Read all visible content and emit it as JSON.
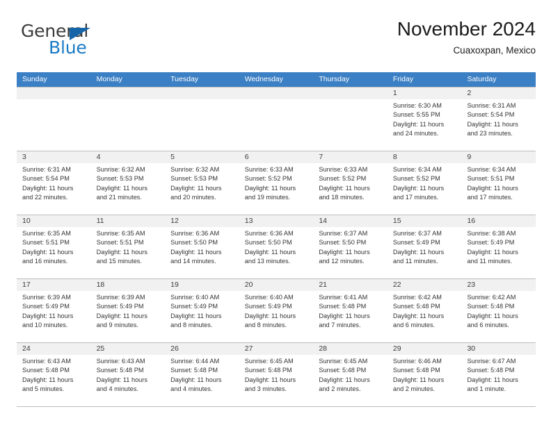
{
  "brand": {
    "name_top": "General",
    "name_bottom": "Blue",
    "accent_color": "#1b7ac4",
    "triangle_color": "#1565a8"
  },
  "header": {
    "title": "November 2024",
    "subtitle": "Cuaxoxpan, Mexico"
  },
  "theme": {
    "weekday_header_bg": "#3b7fc4",
    "day_number_bg": "#f1f1f1",
    "grid_line": "#bcbcbc"
  },
  "weekdays": [
    "Sunday",
    "Monday",
    "Tuesday",
    "Wednesday",
    "Thursday",
    "Friday",
    "Saturday"
  ],
  "weeks": [
    [
      {
        "day": "",
        "sunrise": "",
        "sunset": "",
        "daylight1": "",
        "daylight2": ""
      },
      {
        "day": "",
        "sunrise": "",
        "sunset": "",
        "daylight1": "",
        "daylight2": ""
      },
      {
        "day": "",
        "sunrise": "",
        "sunset": "",
        "daylight1": "",
        "daylight2": ""
      },
      {
        "day": "",
        "sunrise": "",
        "sunset": "",
        "daylight1": "",
        "daylight2": ""
      },
      {
        "day": "",
        "sunrise": "",
        "sunset": "",
        "daylight1": "",
        "daylight2": ""
      },
      {
        "day": "1",
        "sunrise": "Sunrise: 6:30 AM",
        "sunset": "Sunset: 5:55 PM",
        "daylight1": "Daylight: 11 hours",
        "daylight2": "and 24 minutes."
      },
      {
        "day": "2",
        "sunrise": "Sunrise: 6:31 AM",
        "sunset": "Sunset: 5:54 PM",
        "daylight1": "Daylight: 11 hours",
        "daylight2": "and 23 minutes."
      }
    ],
    [
      {
        "day": "3",
        "sunrise": "Sunrise: 6:31 AM",
        "sunset": "Sunset: 5:54 PM",
        "daylight1": "Daylight: 11 hours",
        "daylight2": "and 22 minutes."
      },
      {
        "day": "4",
        "sunrise": "Sunrise: 6:32 AM",
        "sunset": "Sunset: 5:53 PM",
        "daylight1": "Daylight: 11 hours",
        "daylight2": "and 21 minutes."
      },
      {
        "day": "5",
        "sunrise": "Sunrise: 6:32 AM",
        "sunset": "Sunset: 5:53 PM",
        "daylight1": "Daylight: 11 hours",
        "daylight2": "and 20 minutes."
      },
      {
        "day": "6",
        "sunrise": "Sunrise: 6:33 AM",
        "sunset": "Sunset: 5:52 PM",
        "daylight1": "Daylight: 11 hours",
        "daylight2": "and 19 minutes."
      },
      {
        "day": "7",
        "sunrise": "Sunrise: 6:33 AM",
        "sunset": "Sunset: 5:52 PM",
        "daylight1": "Daylight: 11 hours",
        "daylight2": "and 18 minutes."
      },
      {
        "day": "8",
        "sunrise": "Sunrise: 6:34 AM",
        "sunset": "Sunset: 5:52 PM",
        "daylight1": "Daylight: 11 hours",
        "daylight2": "and 17 minutes."
      },
      {
        "day": "9",
        "sunrise": "Sunrise: 6:34 AM",
        "sunset": "Sunset: 5:51 PM",
        "daylight1": "Daylight: 11 hours",
        "daylight2": "and 17 minutes."
      }
    ],
    [
      {
        "day": "10",
        "sunrise": "Sunrise: 6:35 AM",
        "sunset": "Sunset: 5:51 PM",
        "daylight1": "Daylight: 11 hours",
        "daylight2": "and 16 minutes."
      },
      {
        "day": "11",
        "sunrise": "Sunrise: 6:35 AM",
        "sunset": "Sunset: 5:51 PM",
        "daylight1": "Daylight: 11 hours",
        "daylight2": "and 15 minutes."
      },
      {
        "day": "12",
        "sunrise": "Sunrise: 6:36 AM",
        "sunset": "Sunset: 5:50 PM",
        "daylight1": "Daylight: 11 hours",
        "daylight2": "and 14 minutes."
      },
      {
        "day": "13",
        "sunrise": "Sunrise: 6:36 AM",
        "sunset": "Sunset: 5:50 PM",
        "daylight1": "Daylight: 11 hours",
        "daylight2": "and 13 minutes."
      },
      {
        "day": "14",
        "sunrise": "Sunrise: 6:37 AM",
        "sunset": "Sunset: 5:50 PM",
        "daylight1": "Daylight: 11 hours",
        "daylight2": "and 12 minutes."
      },
      {
        "day": "15",
        "sunrise": "Sunrise: 6:37 AM",
        "sunset": "Sunset: 5:49 PM",
        "daylight1": "Daylight: 11 hours",
        "daylight2": "and 11 minutes."
      },
      {
        "day": "16",
        "sunrise": "Sunrise: 6:38 AM",
        "sunset": "Sunset: 5:49 PM",
        "daylight1": "Daylight: 11 hours",
        "daylight2": "and 11 minutes."
      }
    ],
    [
      {
        "day": "17",
        "sunrise": "Sunrise: 6:39 AM",
        "sunset": "Sunset: 5:49 PM",
        "daylight1": "Daylight: 11 hours",
        "daylight2": "and 10 minutes."
      },
      {
        "day": "18",
        "sunrise": "Sunrise: 6:39 AM",
        "sunset": "Sunset: 5:49 PM",
        "daylight1": "Daylight: 11 hours",
        "daylight2": "and 9 minutes."
      },
      {
        "day": "19",
        "sunrise": "Sunrise: 6:40 AM",
        "sunset": "Sunset: 5:49 PM",
        "daylight1": "Daylight: 11 hours",
        "daylight2": "and 8 minutes."
      },
      {
        "day": "20",
        "sunrise": "Sunrise: 6:40 AM",
        "sunset": "Sunset: 5:49 PM",
        "daylight1": "Daylight: 11 hours",
        "daylight2": "and 8 minutes."
      },
      {
        "day": "21",
        "sunrise": "Sunrise: 6:41 AM",
        "sunset": "Sunset: 5:48 PM",
        "daylight1": "Daylight: 11 hours",
        "daylight2": "and 7 minutes."
      },
      {
        "day": "22",
        "sunrise": "Sunrise: 6:42 AM",
        "sunset": "Sunset: 5:48 PM",
        "daylight1": "Daylight: 11 hours",
        "daylight2": "and 6 minutes."
      },
      {
        "day": "23",
        "sunrise": "Sunrise: 6:42 AM",
        "sunset": "Sunset: 5:48 PM",
        "daylight1": "Daylight: 11 hours",
        "daylight2": "and 6 minutes."
      }
    ],
    [
      {
        "day": "24",
        "sunrise": "Sunrise: 6:43 AM",
        "sunset": "Sunset: 5:48 PM",
        "daylight1": "Daylight: 11 hours",
        "daylight2": "and 5 minutes."
      },
      {
        "day": "25",
        "sunrise": "Sunrise: 6:43 AM",
        "sunset": "Sunset: 5:48 PM",
        "daylight1": "Daylight: 11 hours",
        "daylight2": "and 4 minutes."
      },
      {
        "day": "26",
        "sunrise": "Sunrise: 6:44 AM",
        "sunset": "Sunset: 5:48 PM",
        "daylight1": "Daylight: 11 hours",
        "daylight2": "and 4 minutes."
      },
      {
        "day": "27",
        "sunrise": "Sunrise: 6:45 AM",
        "sunset": "Sunset: 5:48 PM",
        "daylight1": "Daylight: 11 hours",
        "daylight2": "and 3 minutes."
      },
      {
        "day": "28",
        "sunrise": "Sunrise: 6:45 AM",
        "sunset": "Sunset: 5:48 PM",
        "daylight1": "Daylight: 11 hours",
        "daylight2": "and 2 minutes."
      },
      {
        "day": "29",
        "sunrise": "Sunrise: 6:46 AM",
        "sunset": "Sunset: 5:48 PM",
        "daylight1": "Daylight: 11 hours",
        "daylight2": "and 2 minutes."
      },
      {
        "day": "30",
        "sunrise": "Sunrise: 6:47 AM",
        "sunset": "Sunset: 5:48 PM",
        "daylight1": "Daylight: 11 hours",
        "daylight2": "and 1 minute."
      }
    ]
  ]
}
